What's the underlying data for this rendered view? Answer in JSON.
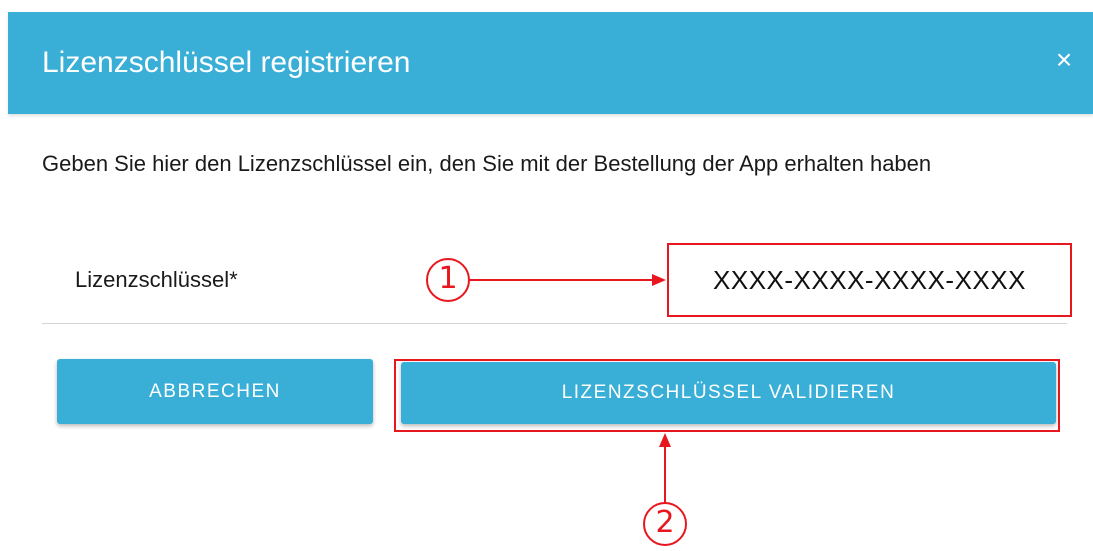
{
  "dialog": {
    "title": "Lizenzschlüssel registrieren",
    "close_icon": "close-icon",
    "close_glyph": "×",
    "instruction": "Geben Sie hier den Lizenzschlüssel ein, den Sie mit der Bestellung der App erhalten haben",
    "field": {
      "label": "Lizenzschlüssel*",
      "value": "XXXX-XXXX-XXXX-XXXX"
    },
    "buttons": {
      "cancel_label": "ABBRECHEN",
      "validate_label": "LIZENZSCHLÜSSEL VALIDIEREN"
    }
  },
  "annotations": {
    "callout_1": "1",
    "callout_2": "2"
  },
  "colors": {
    "accent": "#39aed6",
    "annotation_red": "#e8161d",
    "text": "#1a1a1a",
    "background": "#ffffff"
  }
}
